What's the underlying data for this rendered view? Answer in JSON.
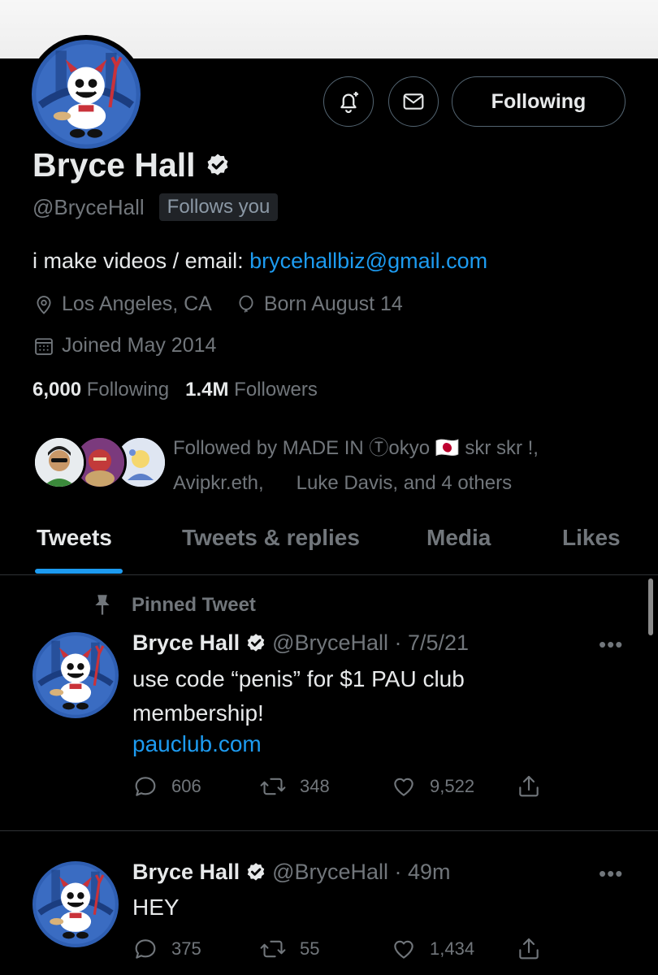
{
  "profile": {
    "name": "Bryce Hall",
    "handle": "@BryceHall",
    "follows_you": "Follows you",
    "follow_button": "Following",
    "bio_text": "i make videos / email: ",
    "bio_link": "brycehallbiz@gmail.com",
    "location": "Los Angeles, CA",
    "birthday": "Born August 14",
    "joined": "Joined May 2014",
    "following_count": "6,000",
    "following_label": "Following",
    "followers_count": "1.4M",
    "followers_label": "Followers",
    "followed_by_line1": "Followed by MADE IN Ⓣokyo 🇯🇵 skr skr !,",
    "followed_by_line2": "Avipkr.eth,      Luke Davis, and 4 others"
  },
  "tabs": [
    {
      "label": "Tweets",
      "active": true
    },
    {
      "label": "Tweets & replies",
      "active": false
    },
    {
      "label": "Media",
      "active": false
    },
    {
      "label": "Likes",
      "active": false
    }
  ],
  "tweets": [
    {
      "pinned_label": "Pinned Tweet",
      "name": "Bryce Hall",
      "handle_time": "@BryceHall · 7/5/21",
      "text": "use code “penis” for $1 PAU club membership!",
      "link": "pauclub.com",
      "replies": "606",
      "retweets": "348",
      "likes": "9,522"
    },
    {
      "name": "Bryce Hall",
      "handle_time": "@BryceHall · 49m",
      "text": "HEY",
      "replies": "375",
      "retweets": "55",
      "likes": "1,434"
    }
  ],
  "icons": {
    "notify": "bell-plus-icon",
    "message": "envelope-icon",
    "verified": "verified-badge-icon",
    "location": "location-pin-icon",
    "birthday": "balloon-icon",
    "joined": "calendar-icon",
    "pin": "pin-icon",
    "reply": "reply-icon",
    "retweet": "retweet-icon",
    "like": "heart-icon",
    "share": "share-icon",
    "more": "more-icon"
  },
  "colors": {
    "background": "#000000",
    "accent": "#1d9bf0",
    "secondary_text": "#71767b",
    "primary_text": "#e7e9ea"
  }
}
